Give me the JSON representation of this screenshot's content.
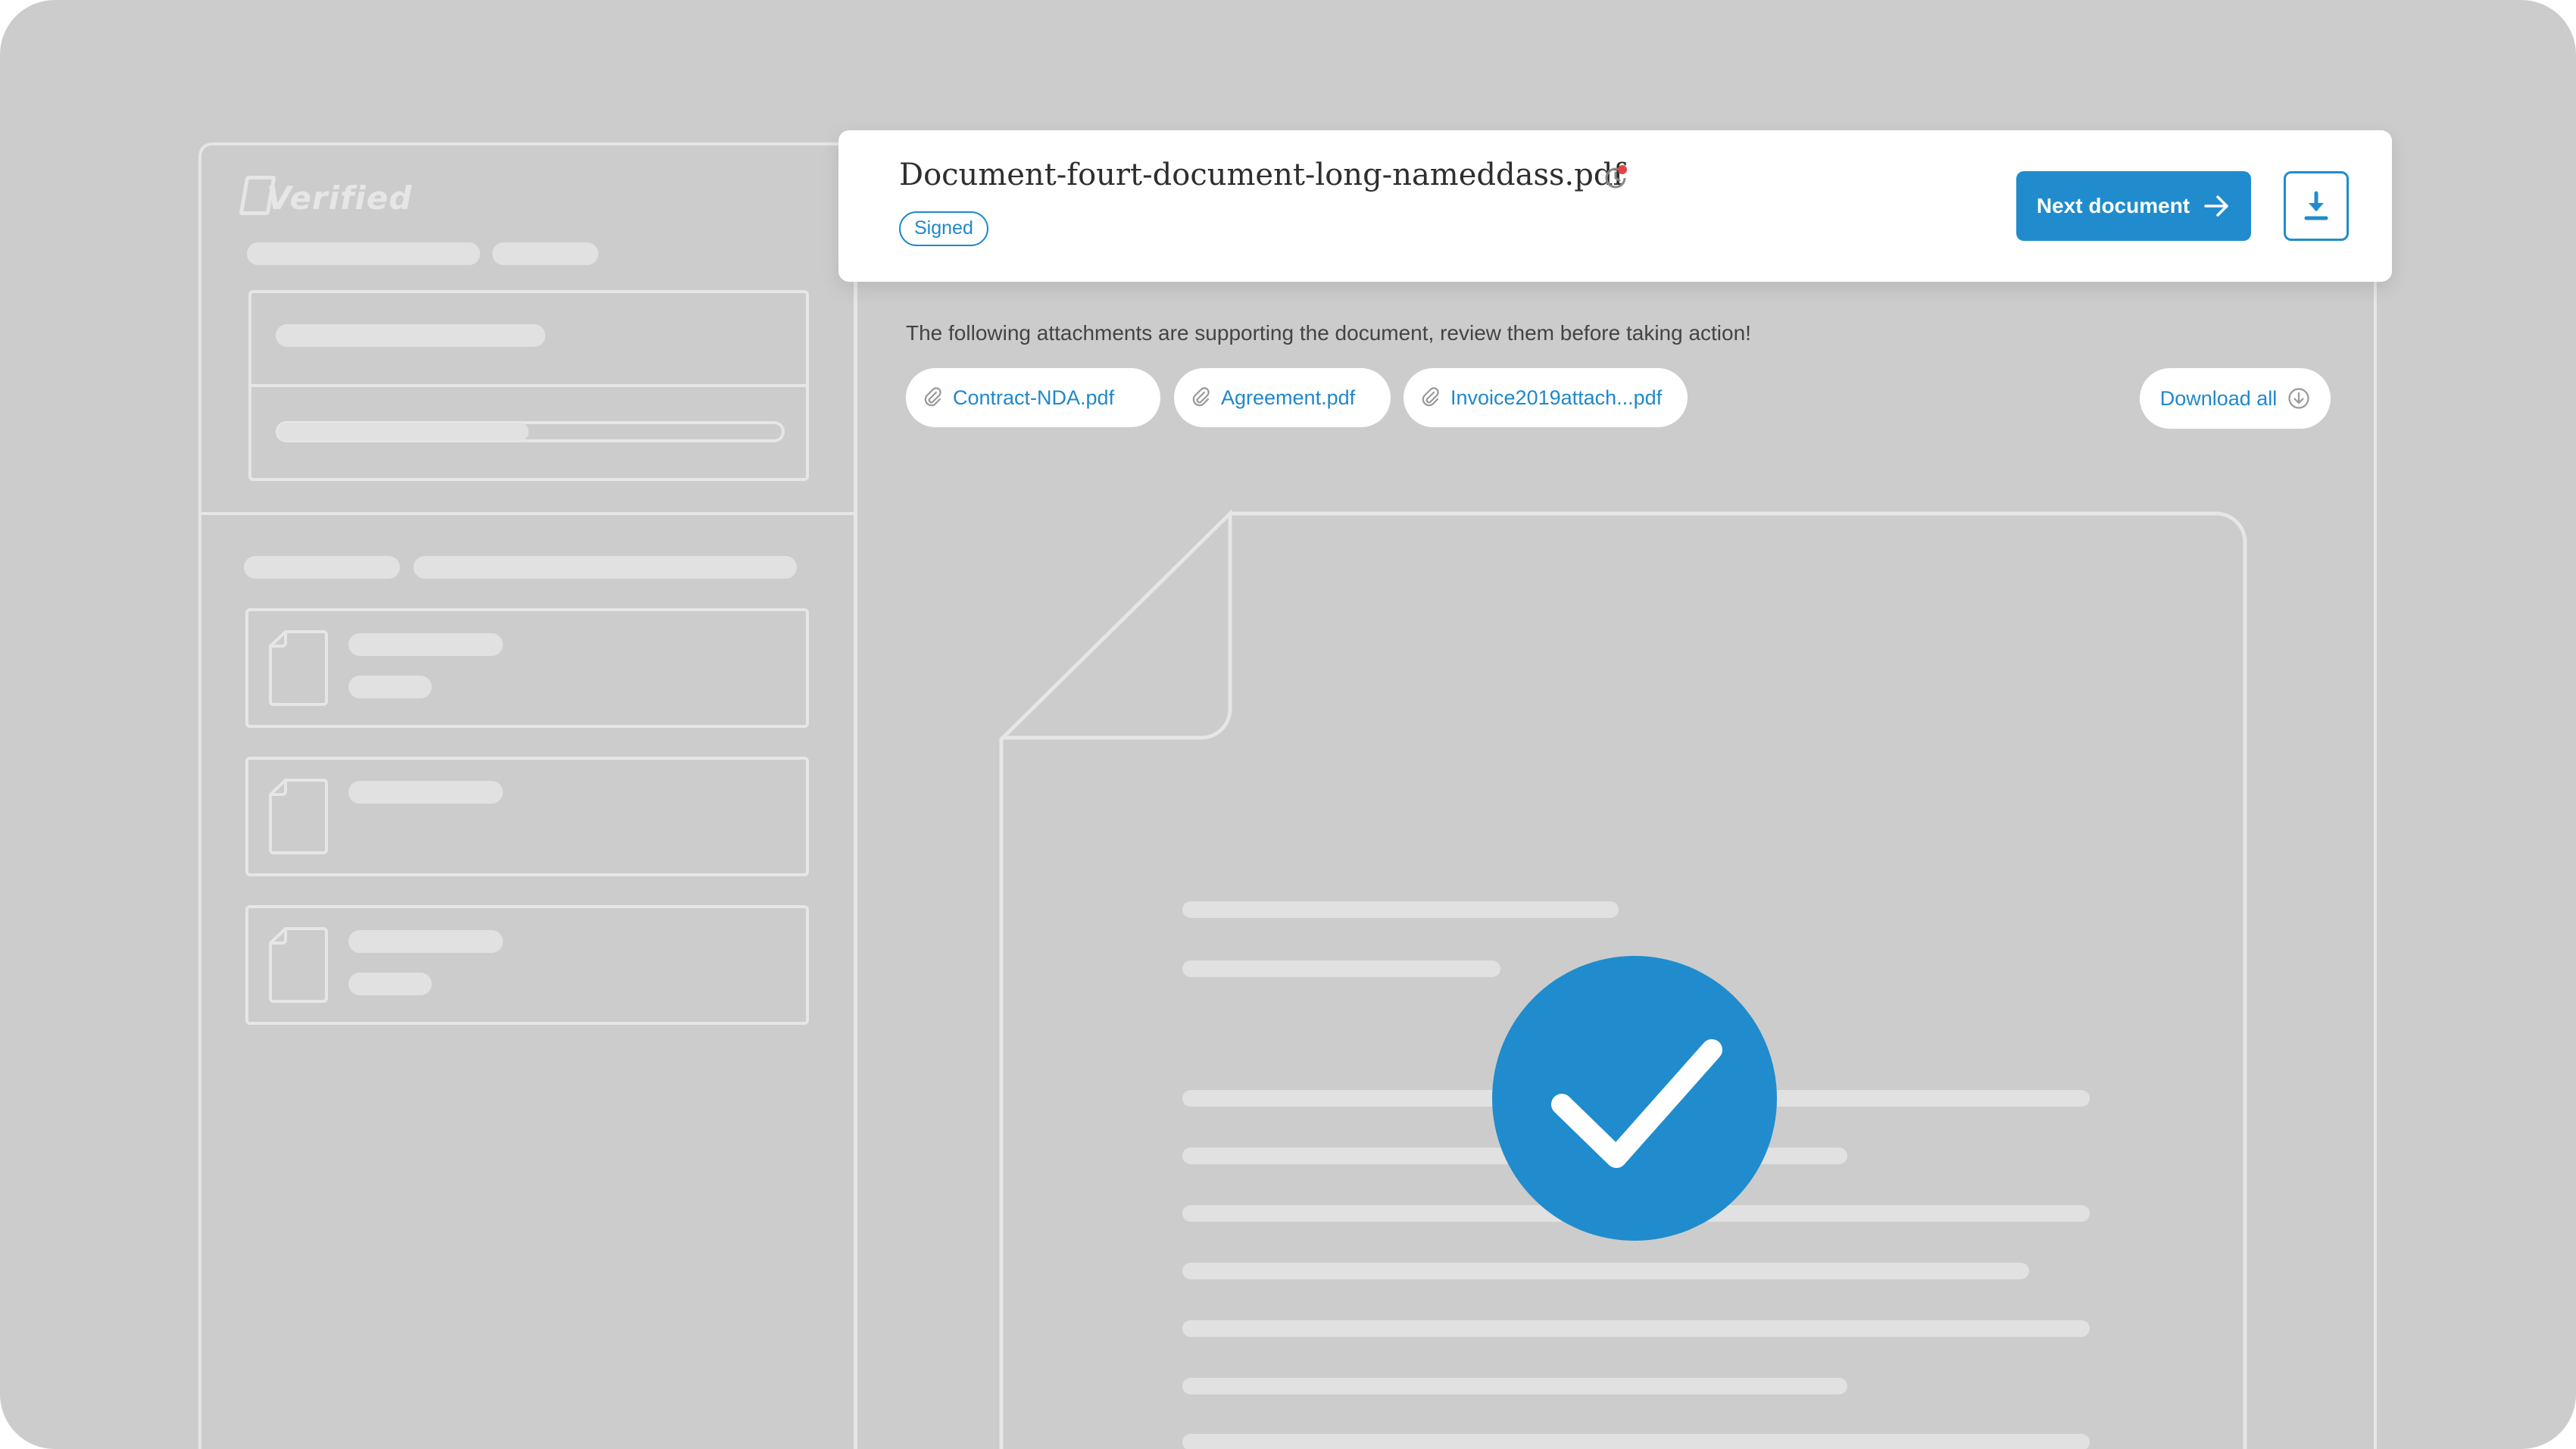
{
  "brand": {
    "logo_text": "Verified"
  },
  "document": {
    "title": "Document-fourt-document-long-nameddass.pdf",
    "status": "Signed"
  },
  "actions": {
    "next_label": "Next document"
  },
  "attachments": {
    "notice": "The following attachments are supporting the document, review them before taking action!",
    "files": [
      {
        "name": "Contract-NDA.pdf"
      },
      {
        "name": "Agreement.pdf"
      },
      {
        "name": "Invoice2019attach...pdf"
      }
    ],
    "download_all_label": "Download all"
  },
  "colors": {
    "accent": "#208ccd",
    "background": "#cccccc",
    "skeleton": "#e1e1e1"
  },
  "icons": [
    "history-icon",
    "arrow-right-icon",
    "download-icon",
    "paperclip-icon",
    "download-circle-icon",
    "check-icon",
    "file-icon"
  ]
}
